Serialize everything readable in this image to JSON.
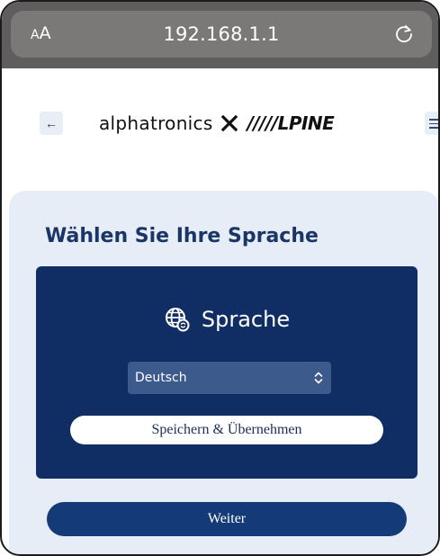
{
  "browser": {
    "text_size_small": "A",
    "text_size_big": "A",
    "url": "192.168.1.1",
    "reload_icon": "reload-icon"
  },
  "header": {
    "back_label": "←",
    "logo_left": "alphatronics",
    "logo_right": "/////LPINE"
  },
  "page": {
    "title": "Wählen Sie Ihre Sprache",
    "language_heading": "Sprache",
    "language_selected": "Deutsch",
    "save_label": "Speichern & Übernehmen",
    "continue_label": "Weiter"
  },
  "colors": {
    "browser_bar": "#5f5d5d",
    "card_background": "#e6edf6",
    "panel_background": "#102e63",
    "select_background": "#3c5a8c",
    "title_color": "#1a3566",
    "continue_button": "#143a77"
  }
}
